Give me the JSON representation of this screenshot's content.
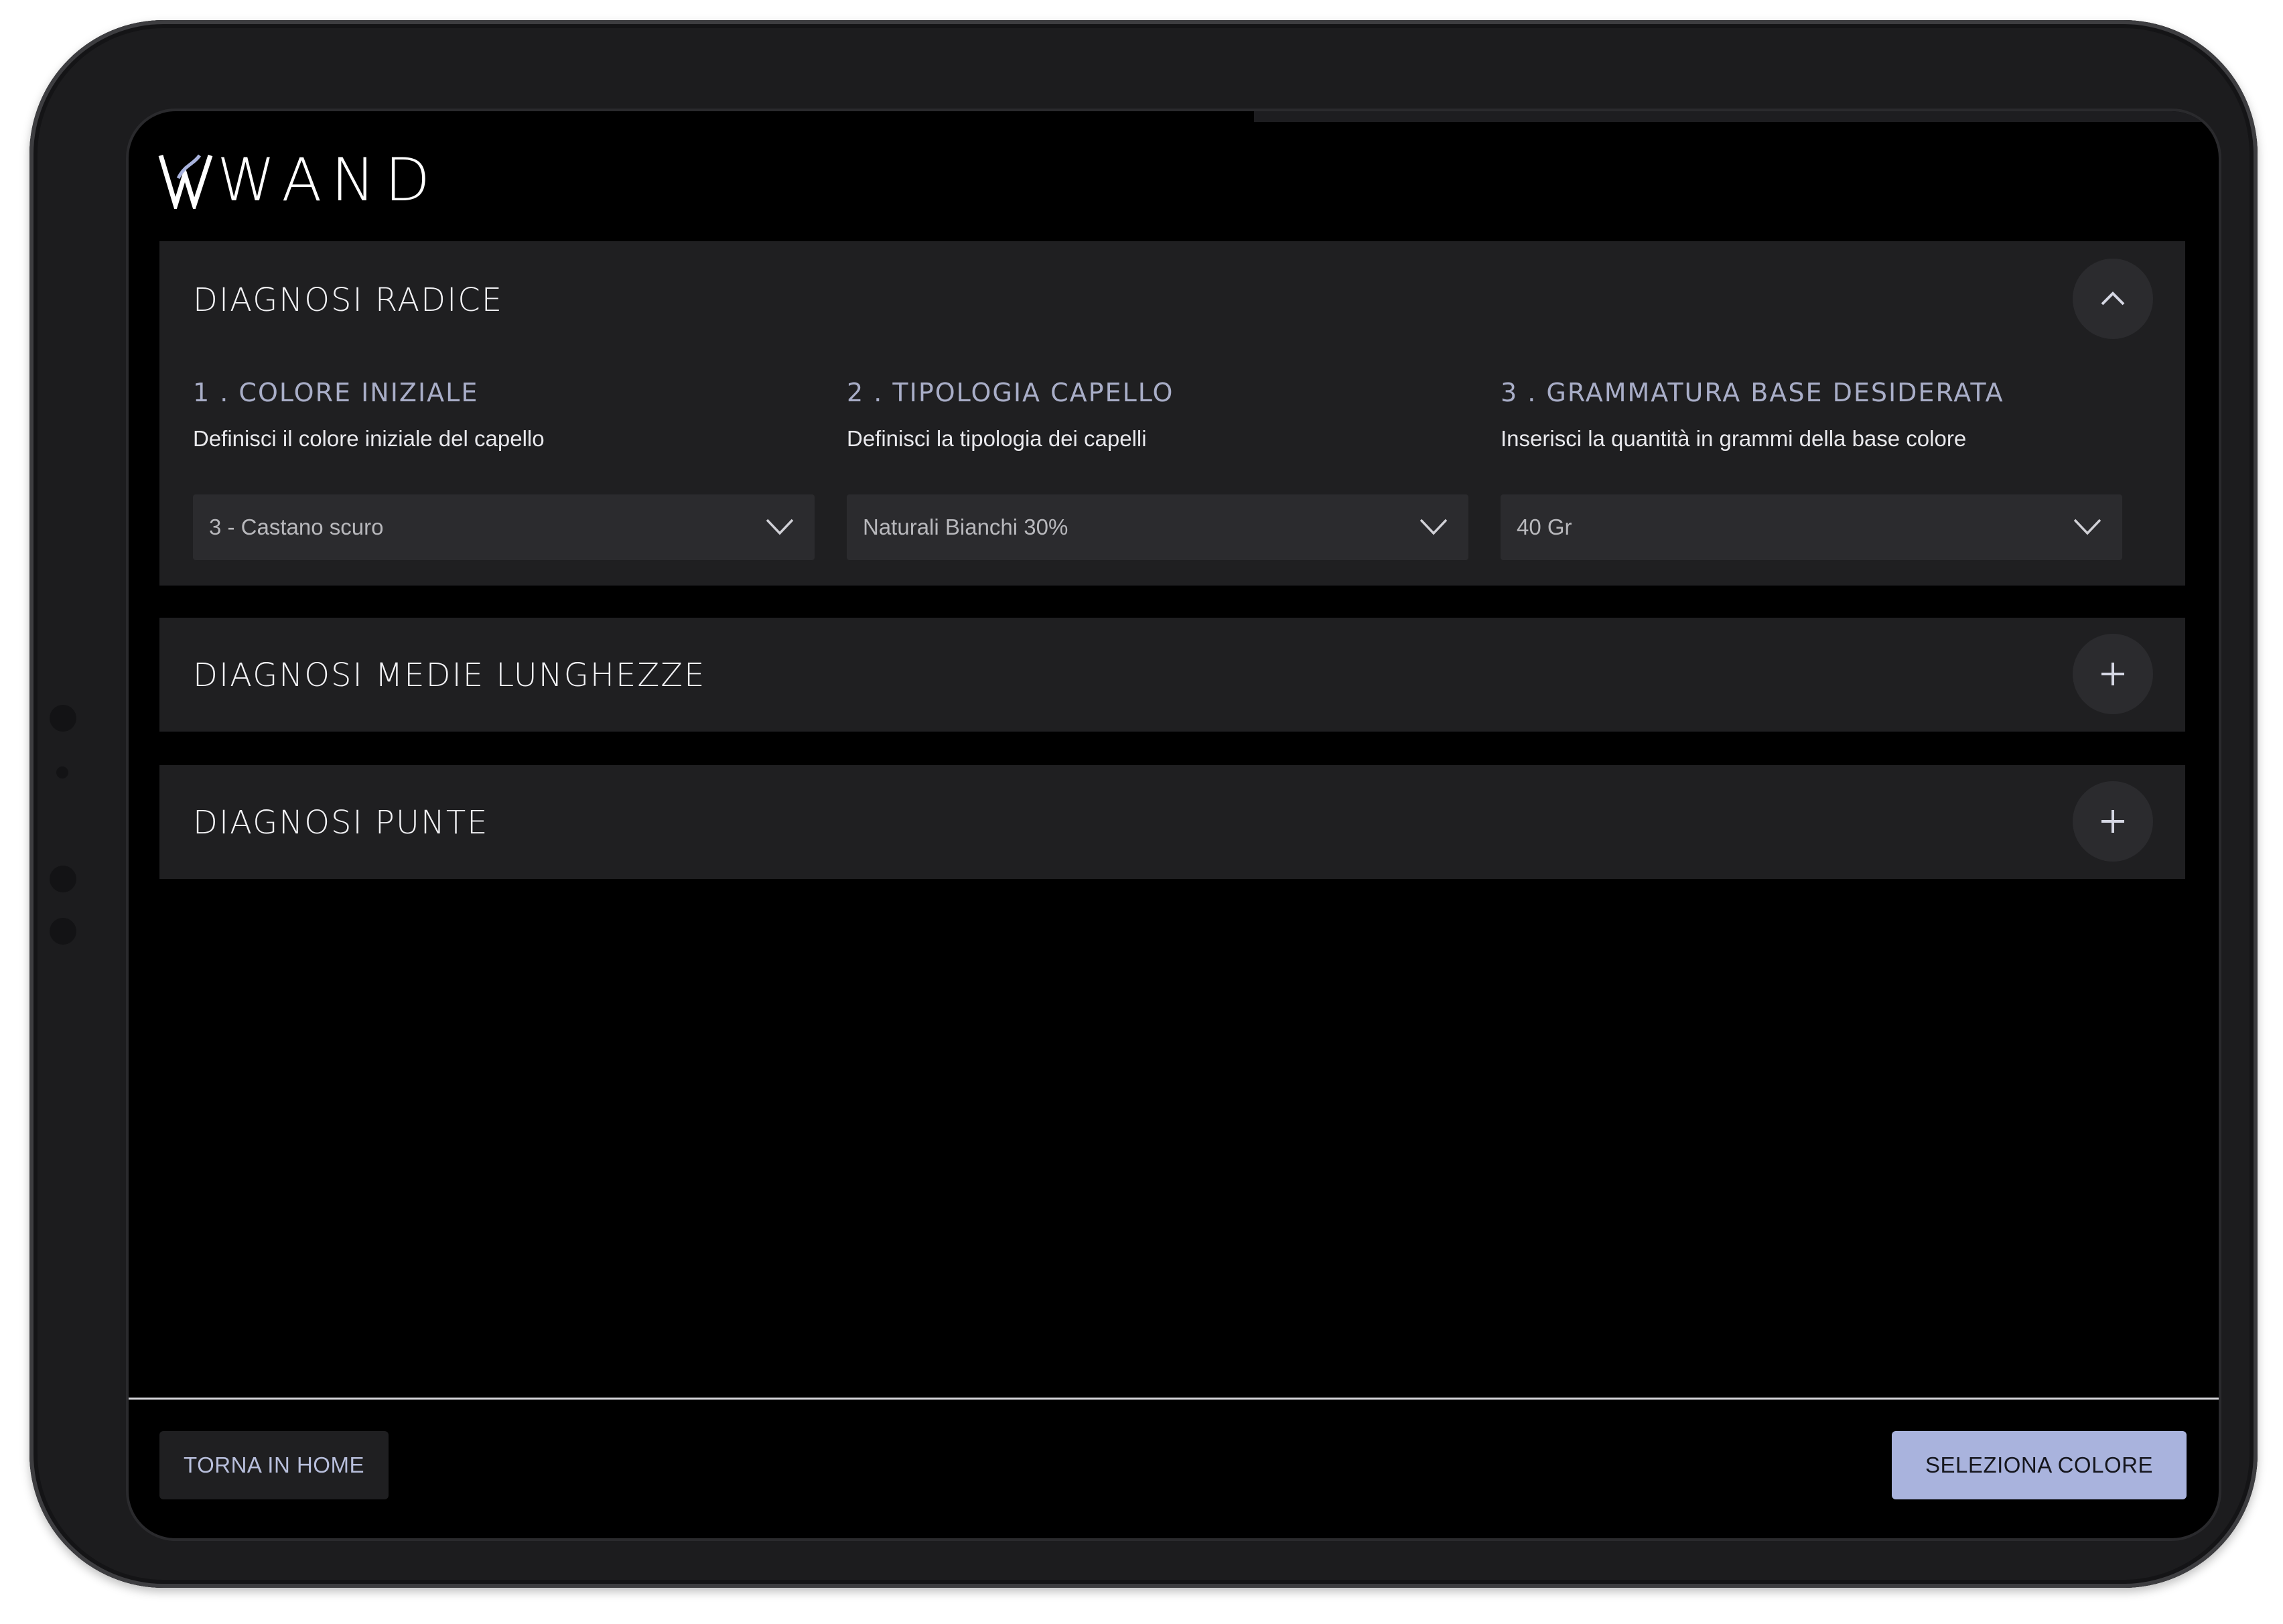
{
  "brand": {
    "logo_text": "WAND",
    "accent_color": "#a9b3dd"
  },
  "sections": [
    {
      "title": "DIAGNOSI RADICE",
      "toggle_icon": "chevron-up-icon",
      "expanded": true,
      "fields": [
        {
          "label": "1 . COLORE INIZIALE",
          "description": "Definisci il colore iniziale del capello",
          "value": "3 - Castano scuro"
        },
        {
          "label": "2 . TIPOLOGIA CAPELLO",
          "description": "Definisci la tipologia dei capelli",
          "value": "Naturali Bianchi 30%"
        },
        {
          "label": "3 . GRAMMATURA BASE DESIDERATA",
          "description": "Inserisci la quantità in grammi della base colore",
          "value": "40 Gr"
        }
      ]
    },
    {
      "title": "DIAGNOSI MEDIE LUNGHEZZE",
      "toggle_icon": "plus-icon",
      "expanded": false
    },
    {
      "title": "DIAGNOSI PUNTE",
      "toggle_icon": "plus-icon",
      "expanded": false
    }
  ],
  "footer": {
    "back_label": "TORNA IN HOME",
    "primary_label": "SELEZIONA COLORE"
  }
}
